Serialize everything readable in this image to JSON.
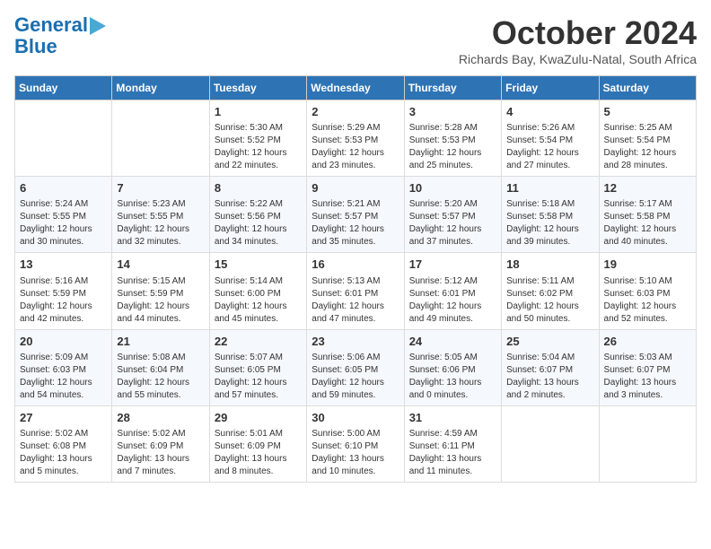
{
  "header": {
    "logo_line1": "General",
    "logo_line2": "Blue",
    "month": "October 2024",
    "location": "Richards Bay, KwaZulu-Natal, South Africa"
  },
  "weekdays": [
    "Sunday",
    "Monday",
    "Tuesday",
    "Wednesday",
    "Thursday",
    "Friday",
    "Saturday"
  ],
  "weeks": [
    [
      {
        "day": "",
        "sunrise": "",
        "sunset": "",
        "daylight": ""
      },
      {
        "day": "",
        "sunrise": "",
        "sunset": "",
        "daylight": ""
      },
      {
        "day": "1",
        "sunrise": "Sunrise: 5:30 AM",
        "sunset": "Sunset: 5:52 PM",
        "daylight": "Daylight: 12 hours and 22 minutes."
      },
      {
        "day": "2",
        "sunrise": "Sunrise: 5:29 AM",
        "sunset": "Sunset: 5:53 PM",
        "daylight": "Daylight: 12 hours and 23 minutes."
      },
      {
        "day": "3",
        "sunrise": "Sunrise: 5:28 AM",
        "sunset": "Sunset: 5:53 PM",
        "daylight": "Daylight: 12 hours and 25 minutes."
      },
      {
        "day": "4",
        "sunrise": "Sunrise: 5:26 AM",
        "sunset": "Sunset: 5:54 PM",
        "daylight": "Daylight: 12 hours and 27 minutes."
      },
      {
        "day": "5",
        "sunrise": "Sunrise: 5:25 AM",
        "sunset": "Sunset: 5:54 PM",
        "daylight": "Daylight: 12 hours and 28 minutes."
      }
    ],
    [
      {
        "day": "6",
        "sunrise": "Sunrise: 5:24 AM",
        "sunset": "Sunset: 5:55 PM",
        "daylight": "Daylight: 12 hours and 30 minutes."
      },
      {
        "day": "7",
        "sunrise": "Sunrise: 5:23 AM",
        "sunset": "Sunset: 5:55 PM",
        "daylight": "Daylight: 12 hours and 32 minutes."
      },
      {
        "day": "8",
        "sunrise": "Sunrise: 5:22 AM",
        "sunset": "Sunset: 5:56 PM",
        "daylight": "Daylight: 12 hours and 34 minutes."
      },
      {
        "day": "9",
        "sunrise": "Sunrise: 5:21 AM",
        "sunset": "Sunset: 5:57 PM",
        "daylight": "Daylight: 12 hours and 35 minutes."
      },
      {
        "day": "10",
        "sunrise": "Sunrise: 5:20 AM",
        "sunset": "Sunset: 5:57 PM",
        "daylight": "Daylight: 12 hours and 37 minutes."
      },
      {
        "day": "11",
        "sunrise": "Sunrise: 5:18 AM",
        "sunset": "Sunset: 5:58 PM",
        "daylight": "Daylight: 12 hours and 39 minutes."
      },
      {
        "day": "12",
        "sunrise": "Sunrise: 5:17 AM",
        "sunset": "Sunset: 5:58 PM",
        "daylight": "Daylight: 12 hours and 40 minutes."
      }
    ],
    [
      {
        "day": "13",
        "sunrise": "Sunrise: 5:16 AM",
        "sunset": "Sunset: 5:59 PM",
        "daylight": "Daylight: 12 hours and 42 minutes."
      },
      {
        "day": "14",
        "sunrise": "Sunrise: 5:15 AM",
        "sunset": "Sunset: 5:59 PM",
        "daylight": "Daylight: 12 hours and 44 minutes."
      },
      {
        "day": "15",
        "sunrise": "Sunrise: 5:14 AM",
        "sunset": "Sunset: 6:00 PM",
        "daylight": "Daylight: 12 hours and 45 minutes."
      },
      {
        "day": "16",
        "sunrise": "Sunrise: 5:13 AM",
        "sunset": "Sunset: 6:01 PM",
        "daylight": "Daylight: 12 hours and 47 minutes."
      },
      {
        "day": "17",
        "sunrise": "Sunrise: 5:12 AM",
        "sunset": "Sunset: 6:01 PM",
        "daylight": "Daylight: 12 hours and 49 minutes."
      },
      {
        "day": "18",
        "sunrise": "Sunrise: 5:11 AM",
        "sunset": "Sunset: 6:02 PM",
        "daylight": "Daylight: 12 hours and 50 minutes."
      },
      {
        "day": "19",
        "sunrise": "Sunrise: 5:10 AM",
        "sunset": "Sunset: 6:03 PM",
        "daylight": "Daylight: 12 hours and 52 minutes."
      }
    ],
    [
      {
        "day": "20",
        "sunrise": "Sunrise: 5:09 AM",
        "sunset": "Sunset: 6:03 PM",
        "daylight": "Daylight: 12 hours and 54 minutes."
      },
      {
        "day": "21",
        "sunrise": "Sunrise: 5:08 AM",
        "sunset": "Sunset: 6:04 PM",
        "daylight": "Daylight: 12 hours and 55 minutes."
      },
      {
        "day": "22",
        "sunrise": "Sunrise: 5:07 AM",
        "sunset": "Sunset: 6:05 PM",
        "daylight": "Daylight: 12 hours and 57 minutes."
      },
      {
        "day": "23",
        "sunrise": "Sunrise: 5:06 AM",
        "sunset": "Sunset: 6:05 PM",
        "daylight": "Daylight: 12 hours and 59 minutes."
      },
      {
        "day": "24",
        "sunrise": "Sunrise: 5:05 AM",
        "sunset": "Sunset: 6:06 PM",
        "daylight": "Daylight: 13 hours and 0 minutes."
      },
      {
        "day": "25",
        "sunrise": "Sunrise: 5:04 AM",
        "sunset": "Sunset: 6:07 PM",
        "daylight": "Daylight: 13 hours and 2 minutes."
      },
      {
        "day": "26",
        "sunrise": "Sunrise: 5:03 AM",
        "sunset": "Sunset: 6:07 PM",
        "daylight": "Daylight: 13 hours and 3 minutes."
      }
    ],
    [
      {
        "day": "27",
        "sunrise": "Sunrise: 5:02 AM",
        "sunset": "Sunset: 6:08 PM",
        "daylight": "Daylight: 13 hours and 5 minutes."
      },
      {
        "day": "28",
        "sunrise": "Sunrise: 5:02 AM",
        "sunset": "Sunset: 6:09 PM",
        "daylight": "Daylight: 13 hours and 7 minutes."
      },
      {
        "day": "29",
        "sunrise": "Sunrise: 5:01 AM",
        "sunset": "Sunset: 6:09 PM",
        "daylight": "Daylight: 13 hours and 8 minutes."
      },
      {
        "day": "30",
        "sunrise": "Sunrise: 5:00 AM",
        "sunset": "Sunset: 6:10 PM",
        "daylight": "Daylight: 13 hours and 10 minutes."
      },
      {
        "day": "31",
        "sunrise": "Sunrise: 4:59 AM",
        "sunset": "Sunset: 6:11 PM",
        "daylight": "Daylight: 13 hours and 11 minutes."
      },
      {
        "day": "",
        "sunrise": "",
        "sunset": "",
        "daylight": ""
      },
      {
        "day": "",
        "sunrise": "",
        "sunset": "",
        "daylight": ""
      }
    ]
  ]
}
